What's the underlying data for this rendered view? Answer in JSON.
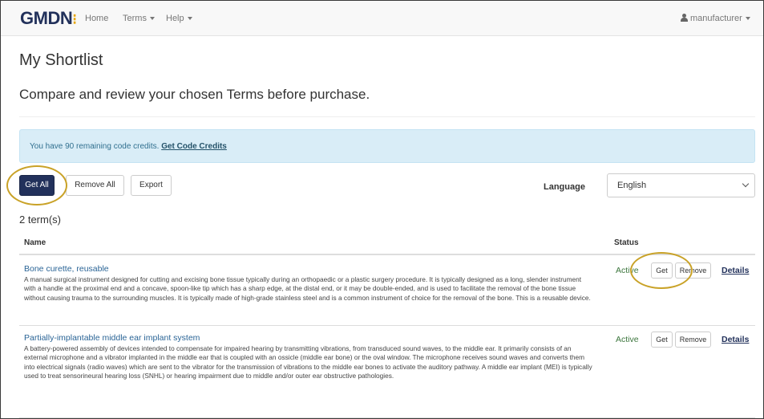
{
  "navbar": {
    "brand": "GMDN",
    "brand_dots": "⁝",
    "home": "Home",
    "terms": "Terms",
    "help": "Help",
    "user": "manufacturer"
  },
  "page": {
    "title": "My Shortlist",
    "subtitle": "Compare and review your chosen Terms before purchase."
  },
  "alert": {
    "text": "You have 90 remaining code credits.",
    "link": "Get Code Credits"
  },
  "toolbar": {
    "get_all": "Get All",
    "remove_all": "Remove All",
    "export": "Export",
    "language_label": "Language",
    "language_value": "English"
  },
  "count": "2 term(s)",
  "table": {
    "headers": {
      "name": "Name",
      "status": "Status"
    },
    "rows": [
      {
        "name": "Bone curette, reusable",
        "description": "A manual surgical instrument designed for cutting and excising bone tissue typically during an orthopaedic or a plastic surgery procedure. It is typically designed as a long, slender instrument with a handle at the proximal end and a concave, spoon-like tip which has a sharp edge, at the distal end, or it may be double-ended, and is used to facilitate the removal of the bone tissue without causing trauma to the surrounding muscles. It is typically made of high-grade stainless steel and is a common instrument of choice for the removal of the bone. This is a reusable device.",
        "status": "Active",
        "get": "Get",
        "remove": "Remove",
        "details": "Details"
      },
      {
        "name": "Partially-implantable middle ear implant system",
        "description": "A battery-powered assembly of devices intended to compensate for impaired hearing by transmitting vibrations, from transduced sound waves, to the middle ear. It primarily consists of an external microphone and a vibrator implanted in the middle ear that is coupled with an ossicle (middle ear bone) or the oval window. The microphone receives sound waves and converts them into electrical signals (radio waves) which are sent to the vibrator for the transmission of vibrations to the middle ear bones to activate the auditory pathway. A middle ear implant (MEI) is typically used to treat sensorineural hearing loss (SNHL) or hearing impairment due to middle and/or outer ear obstructive pathologies.",
        "status": "Active",
        "get": "Get",
        "remove": "Remove",
        "details": "Details"
      }
    ]
  },
  "colors": {
    "brand": "#22315b",
    "accent": "#e8a500",
    "highlight_ring": "#c9a227",
    "alert_bg": "#d9edf7",
    "active": "#3c763d"
  }
}
